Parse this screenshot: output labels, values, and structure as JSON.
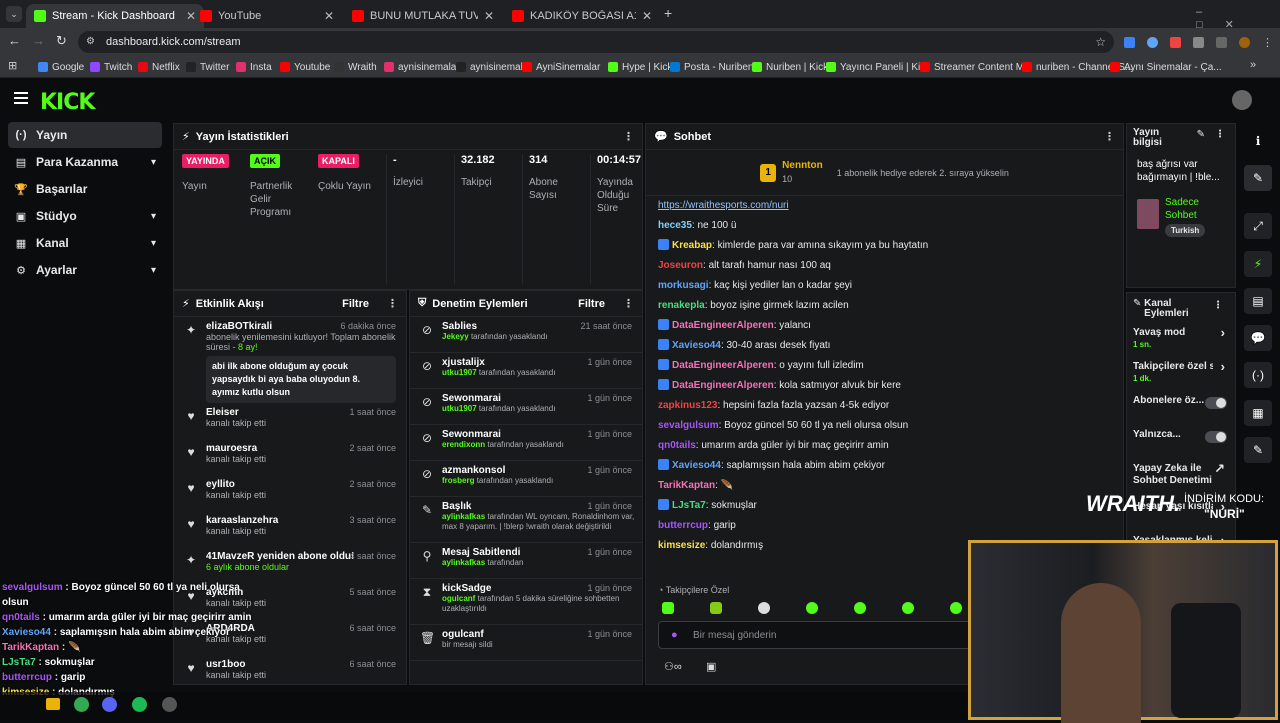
{
  "browser": {
    "tabs": [
      {
        "title": "Stream - Kick Dashboard",
        "favicon_color": "#53fc18"
      },
      {
        "title": "YouTube",
        "favicon_color": "#ff0000"
      },
      {
        "title": "BUNU MUTLAKA TUVALETTE K",
        "favicon_color": "#ff0000"
      },
      {
        "title": "KADIKÖY BOĞASI A101 VS BİM",
        "favicon_color": "#ff0000"
      }
    ],
    "url": "dashboard.kick.com/stream",
    "bookmarks": [
      {
        "label": "Google",
        "color": "#4285f4"
      },
      {
        "label": "Twitch",
        "color": "#9146ff"
      },
      {
        "label": "Netflix",
        "color": "#e50914"
      },
      {
        "label": "Twitter",
        "color": "#222222"
      },
      {
        "label": "Insta",
        "color": "#e1306c"
      },
      {
        "label": "Youtube",
        "color": "#ff0000"
      },
      {
        "label": "Wraith",
        "color": "#333333"
      },
      {
        "label": "aynisinemalar",
        "color": "#e1306c"
      },
      {
        "label": "aynisinemalar",
        "color": "#222222"
      },
      {
        "label": "AyniSinemalar",
        "color": "#ff0000"
      },
      {
        "label": "Hype | Kick",
        "color": "#53fc18"
      },
      {
        "label": "Posta - Nuriben",
        "color": "#0078d4"
      },
      {
        "label": "Nuriben | Kick",
        "color": "#53fc18"
      },
      {
        "label": "Yayıncı Paneli | Kick",
        "color": "#53fc18"
      },
      {
        "label": "Streamer Content M...",
        "color": "#ff0000"
      },
      {
        "label": "nuriben - Channel S...",
        "color": "#ff0000"
      },
      {
        "label": "Aynı Sinemalar - Ça...",
        "color": "#ff0000"
      }
    ]
  },
  "app": {
    "logo": "KICK",
    "nav": [
      {
        "label": "Yayın",
        "icon": "(·)",
        "chevron": false
      },
      {
        "label": "Para Kazanma",
        "icon": "▤",
        "chevron": true
      },
      {
        "label": "Başarılar",
        "icon": "🏆",
        "chevron": false
      },
      {
        "label": "Stüdyo",
        "icon": "▣",
        "chevron": true
      },
      {
        "label": "Kanal",
        "icon": "▦",
        "chevron": true
      },
      {
        "label": "Ayarlar",
        "icon": "⚙",
        "chevron": true
      }
    ],
    "stats": {
      "title": "Yayın İstatistikleri",
      "items": [
        {
          "badge": "YAYINDA",
          "badge_color": "#e91e63",
          "label": "Yayın"
        },
        {
          "badge": "AÇIK",
          "badge_color": "#53fc18",
          "label": "Partnerlik Gelir Programı"
        },
        {
          "badge": "KAPALI",
          "badge_color": "#e91e63",
          "label": "Çoklu Yayın"
        },
        {
          "value": "-",
          "label": "İzleyici"
        },
        {
          "value": "32.182",
          "label": "Takipçi"
        },
        {
          "value": "314",
          "label": "Abone Sayısı"
        },
        {
          "value": "00:14:57",
          "label": "Yayında Olduğu Süre"
        }
      ]
    },
    "activity": {
      "title": "Etkinlik Akışı",
      "filter": "Filtre",
      "top": {
        "name": "elizaBOTkirali",
        "time": "6 dakika önce",
        "sub": "abonelik yenilemesini kutluyor! Toplam abonelik süresi -",
        "months": "8 ay!",
        "quote": "abi ilk abone olduğum ay çocuk yapsaydık bi aya baba oluyodun 8. ayımız kutlu olsun"
      },
      "items": [
        {
          "name": "Eleiser",
          "sub": "kanalı takip etti",
          "time": "1 saat önce",
          "icon": "♥"
        },
        {
          "name": "mauroesra",
          "sub": "kanalı takip etti",
          "time": "2 saat önce",
          "icon": "♥"
        },
        {
          "name": "eyllito",
          "sub": "kanalı takip etti",
          "time": "2 saat önce",
          "icon": "♥"
        },
        {
          "name": "karaaslanzehra",
          "sub": "kanalı takip etti",
          "time": "3 saat önce",
          "icon": "♥"
        },
        {
          "name": "41MavzeR yeniden abone oldu!",
          "sub": "6 aylık abone oldular",
          "time": "4 saat önce",
          "icon": "✦"
        },
        {
          "name": "aykcmn",
          "sub": "kanalı takip etti",
          "time": "5 saat önce",
          "icon": "♥"
        },
        {
          "name": "ARD4RDA",
          "sub": "kanalı takip etti",
          "time": "6 saat önce",
          "icon": "♥"
        },
        {
          "name": "usr1boo",
          "sub": "kanalı takip etti",
          "time": "6 saat önce",
          "icon": "♥"
        }
      ]
    },
    "moderation": {
      "title": "Denetim Eylemleri",
      "filter": "Filtre",
      "items": [
        {
          "name": "Sablies",
          "by": "Jekeyy",
          "action": "tarafından yasaklandı",
          "time": "21 saat önce",
          "icon": "⊘"
        },
        {
          "name": "xjustalijx",
          "by": "utku1907",
          "action": "tarafından yasaklandı",
          "time": "1 gün önce",
          "icon": "⊘"
        },
        {
          "name": "Sewonmarai",
          "by": "utku1907",
          "action": "tarafından yasaklandı",
          "time": "1 gün önce",
          "icon": "⊘"
        },
        {
          "name": "Sewonmarai",
          "by": "erendixonn",
          "action": "tarafından yasaklandı",
          "time": "1 gün önce",
          "icon": "⊘"
        },
        {
          "name": "azmankonsol",
          "by": "frosberg",
          "action": "tarafından yasaklandı",
          "time": "1 gün önce",
          "icon": "⊘"
        },
        {
          "name": "Başlık",
          "by": "aylinkafkas",
          "action": "tarafından WL oyncam, Ronaldinhom var, max 8 yaparım. | !blerp !wraith olarak değiştirildi",
          "time": "1 gün önce",
          "icon": "✎"
        },
        {
          "name": "Mesaj Sabitlendi",
          "by": "aylinkafkas",
          "action": "tarafından",
          "time": "1 gün önce",
          "icon": "⚲"
        },
        {
          "name": "kickSadge",
          "by": "ogulcanf",
          "action": "tarafından 5 dakika süreliğine sohbetten uzaklaştırıldı",
          "time": "1 gün önce",
          "icon": "⧗"
        },
        {
          "name": "ogulcanf",
          "by": "",
          "action": "bir mesajı sildi",
          "time": "1 gün önce",
          "icon": "🗑"
        }
      ]
    },
    "chat": {
      "title": "Sohbet",
      "pinned_user": "Nennton",
      "pinned_count": "10",
      "pinned_text": "1 abonelik hediye ederek 2. sıraya yükselin",
      "link": "https://wraithesports.com/nuri",
      "messages": [
        {
          "user": "hece35",
          "color": "#7dd3fc",
          "text": "ne 100 ü",
          "badge": false
        },
        {
          "user": "Kreabap",
          "color": "#fde047",
          "text": "kimlerde para var amına sıkayım ya bu haytatın",
          "badge": true
        },
        {
          "user": "Joseuron",
          "color": "#ef4444",
          "text": "alt tarafı hamur nası 100 aq",
          "badge": false
        },
        {
          "user": "morkusagi",
          "color": "#60a5fa",
          "text": "kaç kişi yediler lan o kadar şeyi",
          "badge": false
        },
        {
          "user": "renakepla",
          "color": "#4ade80",
          "text": "boyoz işine girmek lazım acilen",
          "badge": false
        },
        {
          "user": "DataEngineerAlperen",
          "color": "#f472b6",
          "text": "yalancı",
          "badge": true
        },
        {
          "user": "Xavieso44",
          "color": "#60a5fa",
          "text": "30-40 arası desek fiyatı",
          "badge": true
        },
        {
          "user": "DataEngineerAlperen",
          "color": "#f472b6",
          "text": "o yayını full izledim",
          "badge": true
        },
        {
          "user": "DataEngineerAlperen",
          "color": "#f472b6",
          "text": "kola satmıyor alvuk bir kere",
          "badge": true
        },
        {
          "user": "zapkinus123",
          "color": "#ef4444",
          "text": "hepsini fazla fazla yazsan 4-5k ediyor",
          "badge": false
        },
        {
          "user": "sevalgulsum",
          "color": "#a855f7",
          "text": "Boyoz güncel 50 60 tl ya neli olursa olsun",
          "badge": false
        },
        {
          "user": "qn0tails",
          "color": "#a855f7",
          "text": "umarım arda güler iyi bir maç geçirirr amin",
          "badge": false
        },
        {
          "user": "Xavieso44",
          "color": "#60a5fa",
          "text": "saplamışsın hala abim abim çekiyor",
          "badge": true
        },
        {
          "user": "TarikKaptan",
          "color": "#f472b6",
          "text": "🪶",
          "badge": false
        },
        {
          "user": "LJsTa7",
          "color": "#4ade80",
          "text": "sokmuşlar",
          "badge": true
        },
        {
          "user": "butterrcup",
          "color": "#a855f7",
          "text": "garip",
          "badge": false
        },
        {
          "user": "kimsesize",
          "color": "#fde047",
          "text": "dolandırmış",
          "badge": false
        }
      ],
      "followers_only": "Takipçilere Özel",
      "input_placeholder": "Bir mesaj gönderin"
    },
    "stream_info": {
      "title": "Yayın bilgisi",
      "text": "baş ağrısı var bağırmayın | !ble...",
      "category": "Sadece Sohbet",
      "tag": "Turkish"
    },
    "channel_actions": {
      "title": "Kanal Eylemleri",
      "items": [
        {
          "label": "Yavaş mod",
          "value": "1 sn."
        },
        {
          "label": "Takipçilere özel s",
          "value": "1 dk."
        },
        {
          "label": "Abonelere öz...",
          "value": ""
        },
        {
          "label": "Yalnızca...",
          "value": ""
        },
        {
          "label": "Yapay Zeka ile Sohbet Denetimi",
          "value": ""
        },
        {
          "label": "Hesap yaşı kısıtla",
          "value": ""
        },
        {
          "label": "Yasaklanmış kelime",
          "value": ""
        }
      ]
    },
    "overlay": {
      "brand": "WRAITH.",
      "promo_label": "İNDİRİM KODU:",
      "promo_code": "\"NURİ\""
    },
    "stream_chat_overlay": [
      {
        "user": "sevalgulsum",
        "color": "#a855f7",
        "text": "Boyoz güncel 50 60 tl ya neli olursa olsun"
      },
      {
        "user": "qn0tails",
        "color": "#a855f7",
        "text": "umarım arda güler iyi bir maç geçirirr amin"
      },
      {
        "user": "Xavieso44",
        "color": "#60a5fa",
        "text": "saplamışsın hala abim abim çekiyor"
      },
      {
        "user": "TarikKaptan",
        "color": "#f472b6",
        "text": "🪶"
      },
      {
        "user": "LJsTa7",
        "color": "#4ade80",
        "text": "sokmuşlar"
      },
      {
        "user": "butterrcup",
        "color": "#a855f7",
        "text": "garip"
      },
      {
        "user": "kimsesize",
        "color": "#fde047",
        "text": "dolandırmış"
      }
    ]
  }
}
